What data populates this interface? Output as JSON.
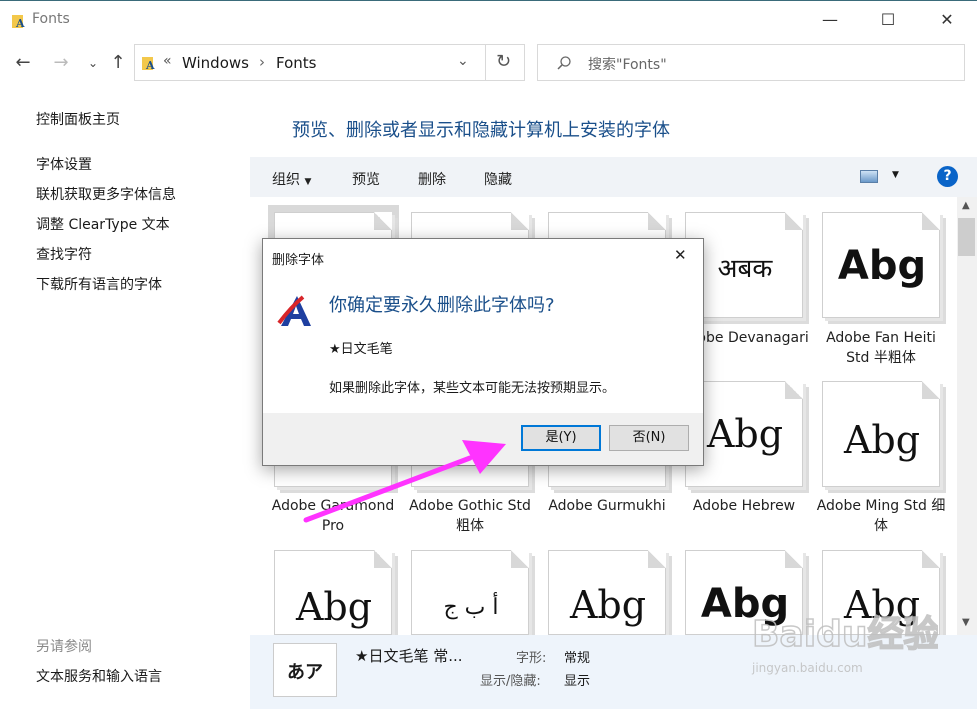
{
  "window": {
    "title": "Fonts",
    "minimize": "—",
    "maximize": "☐",
    "close": "✕"
  },
  "address": {
    "prefix": "«",
    "crumbs": [
      "Windows",
      "Fonts"
    ],
    "separator": "›"
  },
  "search": {
    "placeholder": "搜索\"Fonts\""
  },
  "sidebar": {
    "home": "控制面板主页",
    "links": [
      "字体设置",
      "联机获取更多字体信息",
      "调整 ClearType 文本",
      "查找字符",
      "下载所有语言的字体"
    ],
    "see_also_heading": "另请参阅",
    "see_also": [
      "文本服务和输入语言"
    ]
  },
  "main": {
    "heading": "预览、删除或者显示和隐藏计算机上安装的字体"
  },
  "toolbar": {
    "organize": "组织",
    "preview": "预览",
    "delete": "删除",
    "hide": "隐藏",
    "help": "?"
  },
  "fonts_row1": [
    {
      "glyph": "",
      "name": ""
    },
    {
      "glyph": "",
      "name": ""
    },
    {
      "glyph": "",
      "name": ""
    },
    {
      "glyph": "अबक",
      "name": "Adobe Devanagari"
    },
    {
      "glyph": "Abg",
      "name": "Adobe Fan Heiti Std 半粗体"
    }
  ],
  "fonts_row2": [
    {
      "glyph": "",
      "name": "Adobe Garamond Pro"
    },
    {
      "glyph": "",
      "name": "Adobe Gothic Std 粗体"
    },
    {
      "glyph": "",
      "name": "Adobe Gurmukhi"
    },
    {
      "glyph": "Abg",
      "name": "Adobe Hebrew"
    },
    {
      "glyph": "Abg",
      "name": "Adobe Ming Std 细体"
    }
  ],
  "fonts_row3": [
    {
      "glyph": "Abg"
    },
    {
      "glyph": "أ ب ج"
    },
    {
      "glyph": "Abg"
    },
    {
      "glyph": "Abg"
    },
    {
      "glyph": "Abg"
    }
  ],
  "details": {
    "icon_glyph": "あア",
    "font_name": "★日文毛笔 常...",
    "style_label": "字形:",
    "style_value": "常规",
    "visibility_label": "显示/隐藏:",
    "visibility_value": "显示"
  },
  "dialog": {
    "title": "删除字体",
    "close": "✕",
    "question": "你确定要永久删除此字体吗?",
    "font_name": "★日文毛笔",
    "warning": "如果删除此字体，某些文本可能无法按预期显示。",
    "yes": "是(Y)",
    "no": "否(N)"
  },
  "watermark": {
    "brand": "Baidu经验",
    "url": "jingyan.baidu.com"
  },
  "colors": {
    "accent": "#1a4f8a",
    "arrow": "#ff33ff",
    "toolbar_bg": "#f0f3f7",
    "details_bg": "#eef4fb"
  }
}
